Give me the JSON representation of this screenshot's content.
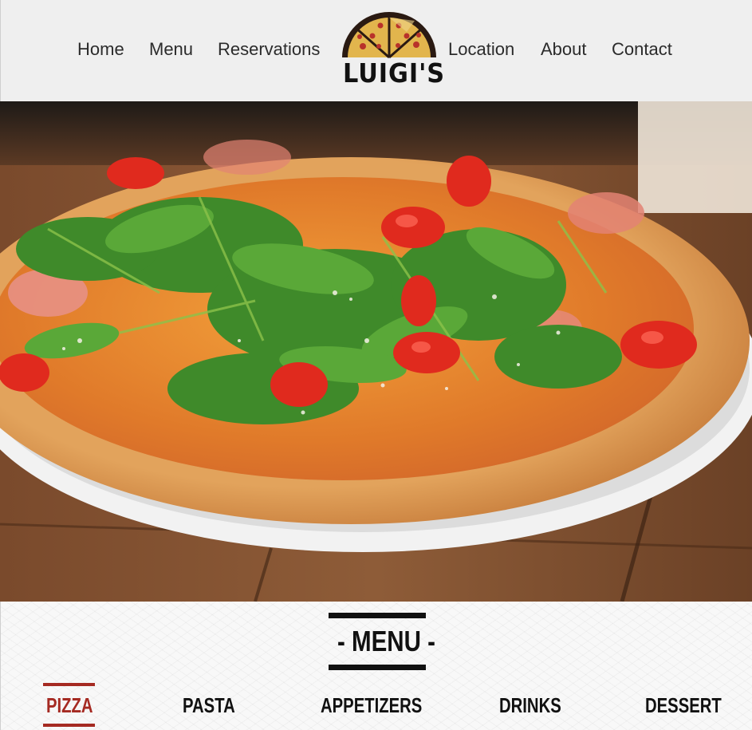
{
  "nav": {
    "left_links": [
      "Home",
      "Menu",
      "Reservations"
    ],
    "right_links": [
      "Location",
      "About",
      "Contact"
    ]
  },
  "logo": {
    "text": "LUIGI'S",
    "icon": "pizza-icon"
  },
  "menu_section": {
    "title": "- MENU -",
    "tabs": [
      "PIZZA",
      "PASTA",
      "APPETIZERS",
      "DRINKS",
      "DESSERT"
    ],
    "active_tab": "PIZZA"
  },
  "colors": {
    "header_bg": "#efefef",
    "active_tab": "#a52a22",
    "text": "#111111"
  }
}
